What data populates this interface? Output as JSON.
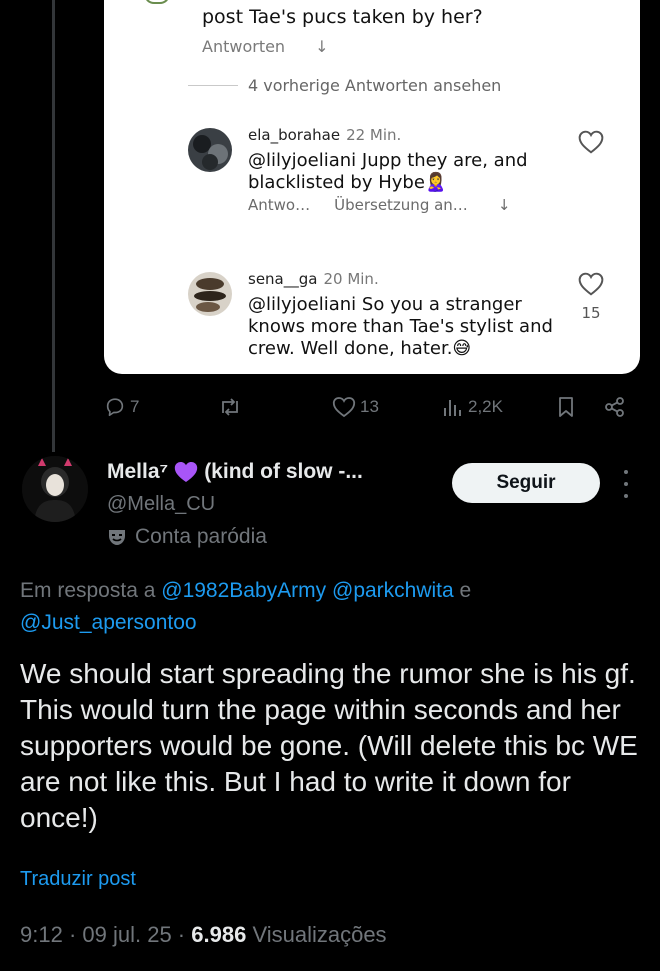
{
  "quoted_card": {
    "prev_text": "post Tae's pucs taken by her?",
    "prev_reply_label": "Antworten",
    "view_previous": "4 vorherige Antworten ansehen",
    "comments": [
      {
        "user": "ela_borahae",
        "time": "22 Min.",
        "text": "@lilyjoeliani Jupp they are, and blacklisted by Hybe🙎‍♀️",
        "reply_label": "Antwo…",
        "translate_label": "Übersetzung an…",
        "like_count": ""
      },
      {
        "user": "sena__ga",
        "time": "20 Min.",
        "text": "@lilyjoeliani So you a stranger knows more than Tae's stylist and crew. Well done, hater.😅",
        "like_count": "15"
      }
    ]
  },
  "stats": {
    "replies": "7",
    "reposts": "",
    "likes": "13",
    "views": "2,2K"
  },
  "post": {
    "author_name": "Mella⁷",
    "author_name_rest": "(kind of slow -...",
    "handle": "@Mella_CU",
    "parody_label": "Conta paródia",
    "follow_label": "Seguir",
    "reply_prefix": "Em resposta a",
    "reply_mentions": [
      "@1982BabyArmy",
      "@parkchwita",
      "@Just_apersontoo"
    ],
    "reply_conjunction": "e",
    "text": "We should start spreading the rumor she is his gf. This would turn the page within seconds and her supporters would be gone. (Will delete this bc WE are not like this. But I had to write it down for once!)",
    "translate_label": "Traduzir post",
    "time": "9:12",
    "date": "09 jul. 25",
    "views_count": "6.986",
    "views_label": "Visualizações"
  },
  "colors": {
    "background": "#000000",
    "accent": "#1d9bf0",
    "muted": "#71767b",
    "heart_emoji": "#a855f7"
  }
}
